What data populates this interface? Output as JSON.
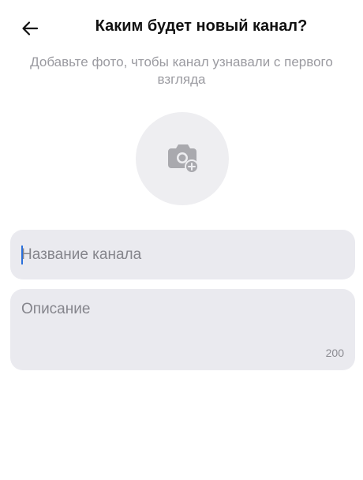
{
  "header": {
    "title": "Каким будет новый канал?",
    "back_icon": "arrow-left-icon"
  },
  "subtitle": "Добавьте фото, чтобы канал узнавали с первого взгляда",
  "avatar": {
    "icon": "camera-add-icon"
  },
  "form": {
    "name_placeholder": "Название канала",
    "name_value": "",
    "description_placeholder": "Описание",
    "description_value": "",
    "description_counter": "200"
  },
  "colors": {
    "field_bg": "#eaeaef",
    "avatar_bg": "#eeeef1",
    "caret": "#2a6fdb",
    "subtitle": "#9a9aa0"
  }
}
